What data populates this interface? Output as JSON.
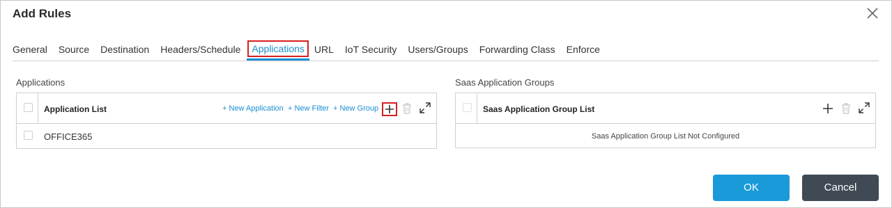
{
  "dialog": {
    "title": "Add Rules"
  },
  "tabs": [
    {
      "label": "General"
    },
    {
      "label": "Source"
    },
    {
      "label": "Destination"
    },
    {
      "label": "Headers/Schedule"
    },
    {
      "label": "Applications",
      "active": true
    },
    {
      "label": "URL"
    },
    {
      "label": "IoT Security"
    },
    {
      "label": "Users/Groups"
    },
    {
      "label": "Forwarding Class"
    },
    {
      "label": "Enforce"
    }
  ],
  "applications": {
    "section_label": "Applications",
    "list_title": "Application List",
    "new_application": "+ New Application",
    "new_filter": "+ New Filter",
    "new_group": "+ New Group",
    "rows": [
      {
        "name": "OFFICE365"
      }
    ]
  },
  "saas": {
    "section_label": "Saas Application Groups",
    "list_title": "Saas Application Group List",
    "empty_message": "Saas Application Group List Not Configured"
  },
  "footer": {
    "ok_label": "OK",
    "cancel_label": "Cancel"
  },
  "colors": {
    "accent": "#1a8fd4",
    "highlight": "#d62020",
    "ok": "#1a9ad9",
    "cancel": "#3f4a55"
  }
}
